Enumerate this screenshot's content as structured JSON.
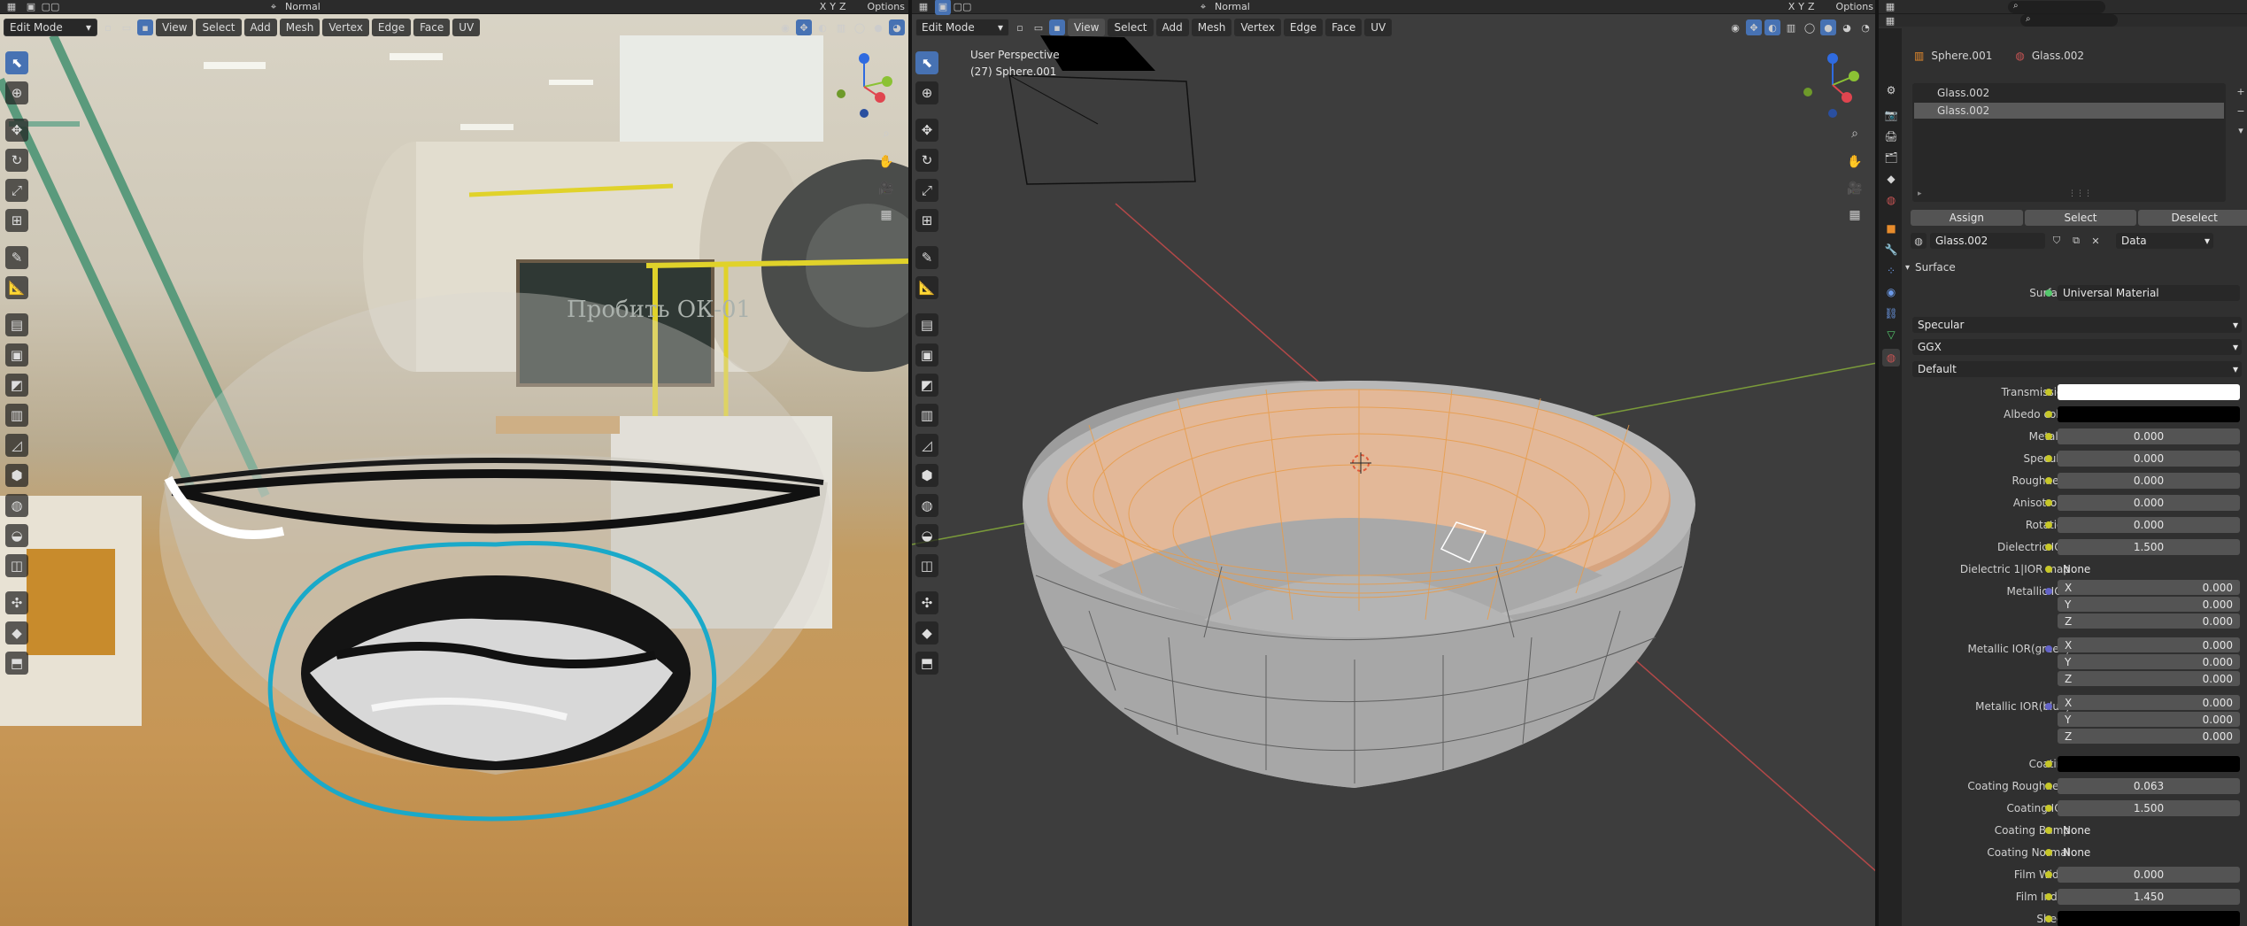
{
  "left_viewport": {
    "mode": "Edit Mode",
    "orientation": "Normal",
    "options": "Options",
    "menus": [
      "View",
      "Select",
      "Add",
      "Mesh",
      "Vertex",
      "Edge",
      "Face",
      "UV"
    ],
    "axes": [
      "X",
      "Y",
      "Z"
    ],
    "chalkboard_text": "Пробить ОК-01"
  },
  "mid_viewport": {
    "mode": "Edit Mode",
    "orientation": "Normal",
    "options": "Options",
    "menus": [
      "View",
      "Select",
      "Add",
      "Mesh",
      "Vertex",
      "Edge",
      "Face",
      "UV"
    ],
    "axes": [
      "X",
      "Y",
      "Z"
    ],
    "perspective": "User Perspective",
    "object_info": "(27) Sphere.001"
  },
  "properties": {
    "breadcrumb_object": "Sphere.001",
    "breadcrumb_material": "Glass.002",
    "slots": [
      "Glass.002",
      "Glass.002"
    ],
    "assign": "Assign",
    "select": "Select",
    "deselect": "Deselect",
    "material_name": "Glass.002",
    "data_link": "Data",
    "section": "Surface",
    "surface_label": "Surface",
    "surface_value": "Universal Material",
    "dropdowns": [
      "Specular",
      "GGX",
      "Default"
    ],
    "rows": [
      {
        "label": "Transmission",
        "value": "",
        "kind": "white"
      },
      {
        "label": "Albedo color",
        "value": "",
        "kind": "black"
      },
      {
        "label": "Metallic",
        "value": "0.000",
        "kind": "num"
      },
      {
        "label": "Specular",
        "value": "0.000",
        "kind": "num"
      },
      {
        "label": "Roughness",
        "value": "0.000",
        "kind": "num"
      },
      {
        "label": "Anisotropy",
        "value": "0.000",
        "kind": "num"
      },
      {
        "label": "Rotation",
        "value": "0.000",
        "kind": "num"
      },
      {
        "label": "Dielectric IOR",
        "value": "1.500",
        "kind": "num"
      },
      {
        "label": "Dielectric 1|IOR map",
        "value": "None",
        "kind": "link"
      }
    ],
    "vectors": [
      {
        "label": "Metallic IOR",
        "x": "0.000",
        "y": "0.000",
        "z": "0.000"
      },
      {
        "label": "Metallic IOR(green)",
        "x": "0.000",
        "y": "0.000",
        "z": "0.000"
      },
      {
        "label": "Metallic IOR(blue)",
        "x": "0.000",
        "y": "0.000",
        "z": "0.000"
      }
    ],
    "rows2": [
      {
        "label": "Coating",
        "value": "",
        "kind": "black"
      },
      {
        "label": "Coating Roughness",
        "value": "0.063",
        "kind": "num"
      },
      {
        "label": "Coating IOR",
        "value": "1.500",
        "kind": "num"
      },
      {
        "label": "Coating Bump",
        "value": "None",
        "kind": "link"
      },
      {
        "label": "Coating Normal",
        "value": "None",
        "kind": "link"
      },
      {
        "label": "Film Width",
        "value": "0.000",
        "kind": "num"
      },
      {
        "label": "Film Index",
        "value": "1.450",
        "kind": "num"
      },
      {
        "label": "Sheen",
        "value": "",
        "kind": "black"
      }
    ]
  },
  "colors": {
    "accent": "#4772b3",
    "selection_orange": "#e89c4a",
    "annotation_cyan": "#1aa9c9"
  }
}
